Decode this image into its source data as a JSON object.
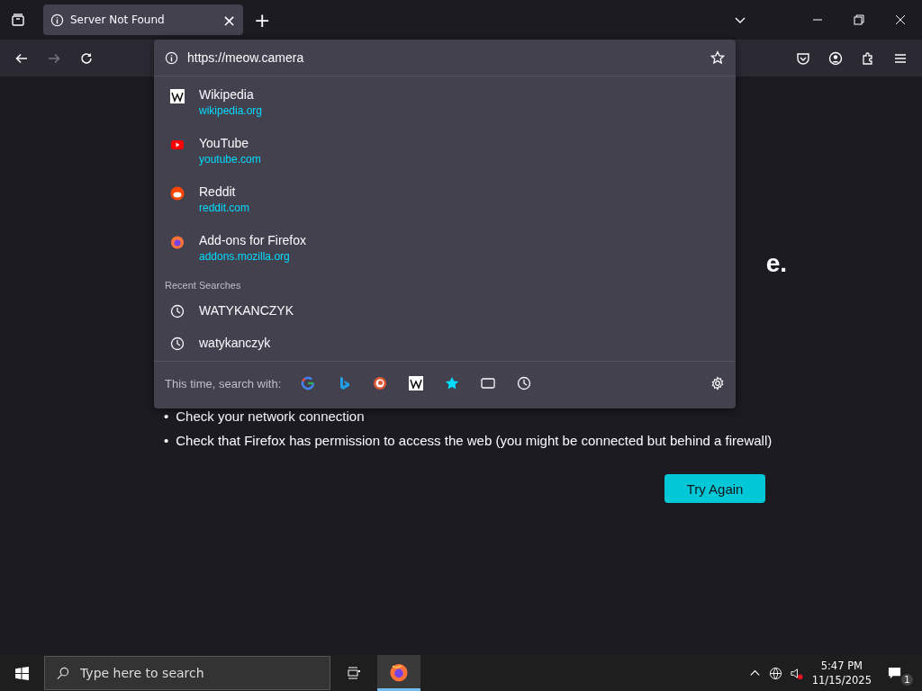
{
  "tab": {
    "title": "Server Not Found",
    "close": "×"
  },
  "new_tab": "+",
  "address_bar": {
    "value": "https://meow.camera"
  },
  "suggestions": [
    {
      "kind": "wikipedia",
      "title": "Wikipedia",
      "url": "wikipedia.org"
    },
    {
      "kind": "youtube",
      "title": "YouTube",
      "url": "youtube.com"
    },
    {
      "kind": "reddit",
      "title": "Reddit",
      "url": "reddit.com"
    },
    {
      "kind": "firefox",
      "title": "Add-ons for Firefox",
      "url": "addons.mozilla.org"
    }
  ],
  "recent_searches": {
    "heading": "Recent Searches",
    "items": [
      "WATYKANCZYK",
      "watykanczyk"
    ]
  },
  "search_with": {
    "label": "This time, search with:",
    "engines": [
      {
        "kind": "google"
      },
      {
        "kind": "bing"
      },
      {
        "kind": "duckduckgo"
      },
      {
        "kind": "wikipedia"
      },
      {
        "kind": "bookmarks"
      },
      {
        "kind": "tabs"
      },
      {
        "kind": "history"
      }
    ]
  },
  "page": {
    "heading_fragment": "e.",
    "checks": [
      {
        "bullet": "•",
        "text": "Check your network connection"
      },
      {
        "bullet": "•",
        "text": "Check that Firefox has permission to access the web (you might be connected but behind a firewall)"
      }
    ],
    "button": "Try Again"
  },
  "taskbar": {
    "search_placeholder": "Type here to search",
    "time": "5:47 PM",
    "date": "11/15/2025",
    "notifications": "1"
  }
}
